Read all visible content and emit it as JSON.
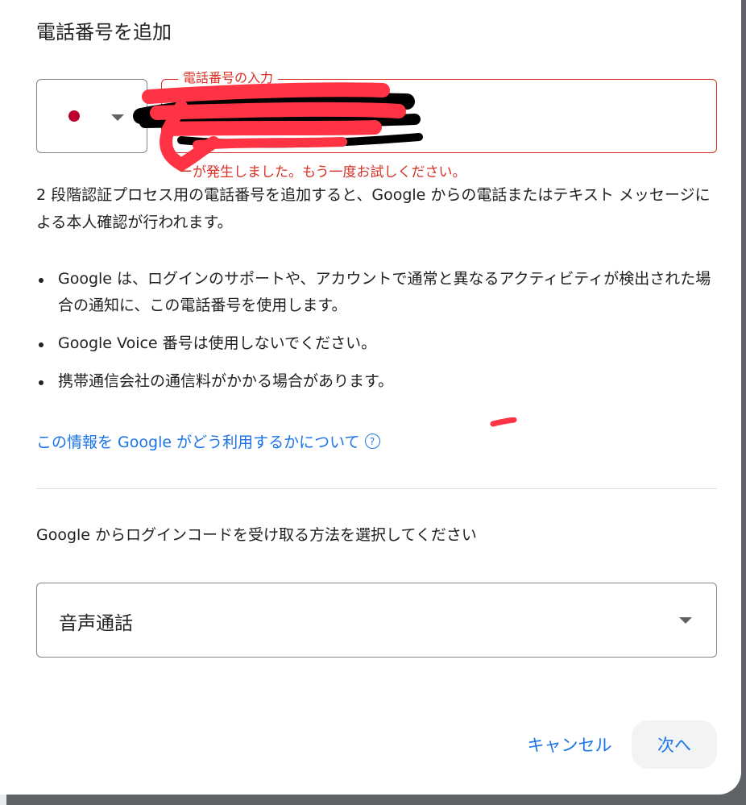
{
  "dialog": {
    "title": "電話番号を追加"
  },
  "country": {
    "flag": "jp-flag-icon"
  },
  "phone": {
    "label": "電話番号の入力",
    "value": "",
    "error": "ーが発生しました。もう一度お試しください。"
  },
  "description": "2 段階認証プロセス用の電話番号を追加すると、Google からの電話またはテキスト メッセージによる本人確認が行われます。",
  "bullets": [
    "Google は、ログインのサポートや、アカウントで通常と異なるアクティビティが検出された場合の通知に、この電話番号を使用します。",
    "Google Voice 番号は使用しないでください。",
    "携帯通信会社の通信料がかかる場合があります。"
  ],
  "info_link": {
    "label": "この情報を Google がどう利用するかについて",
    "icon": "?"
  },
  "method": {
    "question": "Google からログインコードを受け取る方法を選択してください",
    "selected": "音声通話"
  },
  "actions": {
    "cancel": "キャンセル",
    "next": "次へ"
  },
  "colors": {
    "accent": "#1a73e8",
    "error": "#d93025",
    "redaction": "#ff3344"
  }
}
